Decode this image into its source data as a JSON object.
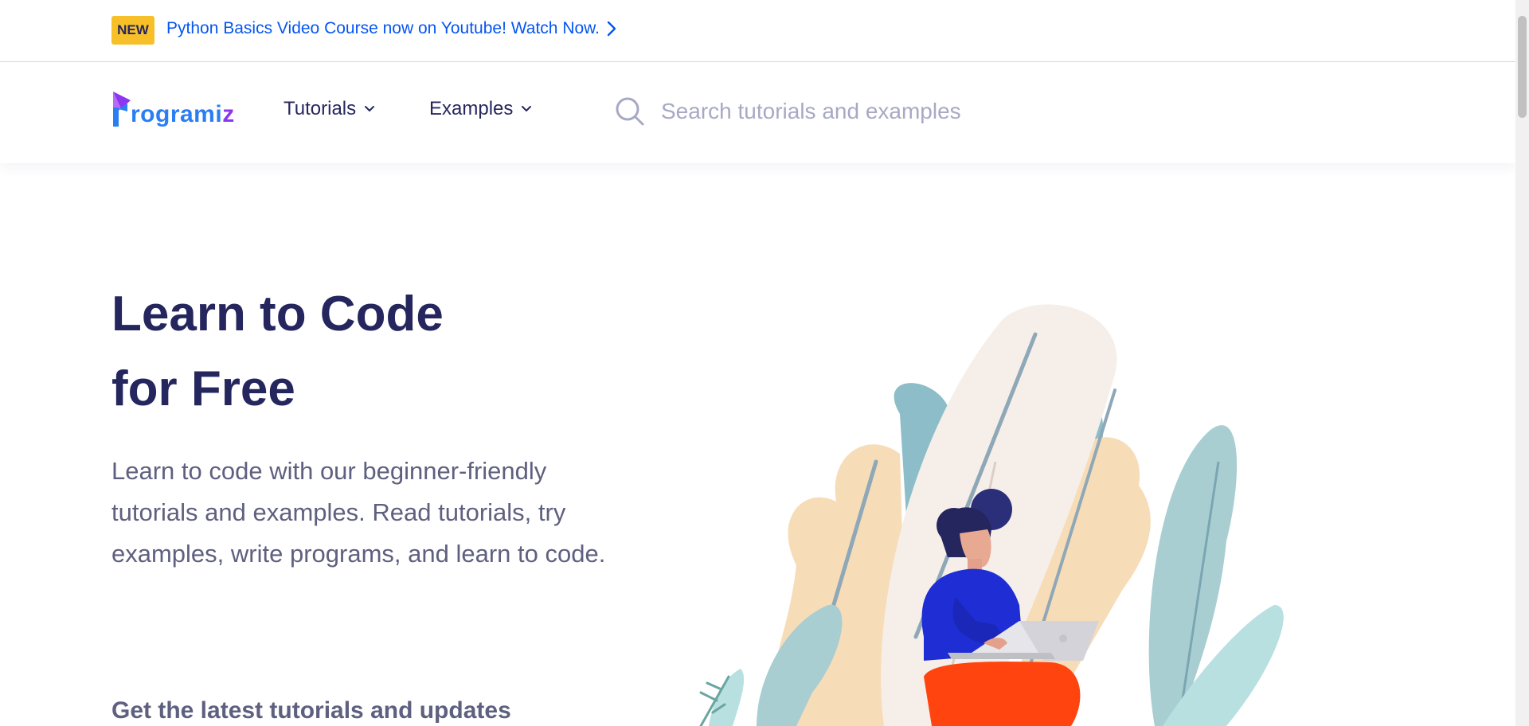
{
  "announcement": {
    "badge": "NEW",
    "text": "Python Basics Video Course now on Youtube! Watch Now."
  },
  "navbar": {
    "logo_text_main": "rogrami",
    "logo_text_end": "z",
    "tutorials_label": "Tutorials",
    "examples_label": "Examples",
    "search_placeholder": "Search tutorials and examples",
    "search_value": ""
  },
  "hero": {
    "title_line1": "Learn to Code",
    "title_line2": "for Free",
    "description": "Learn to code with our beginner-friendly tutorials and examples. Read tutorials, try examples, write programs, and learn to code.",
    "subscribe_heading": "Get the latest tutorials and updates"
  },
  "colors": {
    "brand_blue": "#2a7ef4",
    "brand_purple": "#8d36f1",
    "link_blue": "#0556f3",
    "badge_yellow": "#f7c028",
    "heading_navy": "#25265e",
    "body_gray": "#5e607f"
  },
  "icons": {
    "chevron_right": "chevron-right-icon",
    "chevron_down": "chevron-down-icon",
    "search": "search-icon"
  }
}
